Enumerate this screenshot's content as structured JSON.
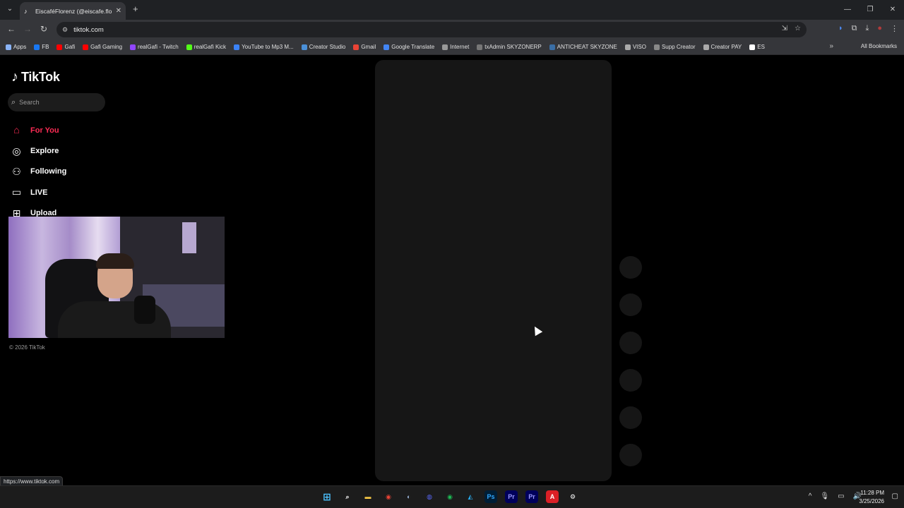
{
  "browser": {
    "tab_title": "EiscaféFlorenz (@eiscafe.florenz",
    "url": "tiktok.com",
    "status_url": "https://www.tiktok.com",
    "bookmarks": [
      {
        "label": "Apps",
        "color": "#8ab4f8"
      },
      {
        "label": "FB",
        "color": "#1877f2"
      },
      {
        "label": "Gafi",
        "color": "#ff0000"
      },
      {
        "label": "Gafi Gaming",
        "color": "#ff0000"
      },
      {
        "label": "realGafi - Twitch",
        "color": "#9146ff"
      },
      {
        "label": "realGafi Kick",
        "color": "#53fc18"
      },
      {
        "label": "YouTube to Mp3 M...",
        "color": "#3b82f6"
      },
      {
        "label": "Creator Studio",
        "color": "#4a90d9"
      },
      {
        "label": "Gmail",
        "color": "#ea4335"
      },
      {
        "label": "Google Translate",
        "color": "#4285f4"
      },
      {
        "label": "Internet",
        "color": "#999999"
      },
      {
        "label": "txAdmin SKYZONERP",
        "color": "#777777"
      },
      {
        "label": "ANTICHEAT SKYZONE",
        "color": "#3a6ea5"
      },
      {
        "label": "VISO",
        "color": "#aaaaaa"
      },
      {
        "label": "Supp Creator",
        "color": "#888888"
      },
      {
        "label": "Creator PAY",
        "color": "#aaaaaa"
      },
      {
        "label": "ES",
        "color": "#ffffff"
      }
    ],
    "all_bookmarks": "All Bookmarks"
  },
  "tiktok": {
    "logo_text": "TikTok",
    "search_placeholder": "Search",
    "nav": [
      {
        "label": "For You",
        "icon": "home-icon",
        "active": true
      },
      {
        "label": "Explore",
        "icon": "compass-icon",
        "active": false
      },
      {
        "label": "Following",
        "icon": "following-icon",
        "active": false
      },
      {
        "label": "LIVE",
        "icon": "live-icon",
        "active": false
      },
      {
        "label": "Upload",
        "icon": "upload-icon",
        "active": false
      }
    ],
    "copyright": "© 2026 TikTok",
    "accent_color": "#fe2c55"
  },
  "taskbar": {
    "time": "11:28 PM",
    "date": "3/25/2026"
  }
}
